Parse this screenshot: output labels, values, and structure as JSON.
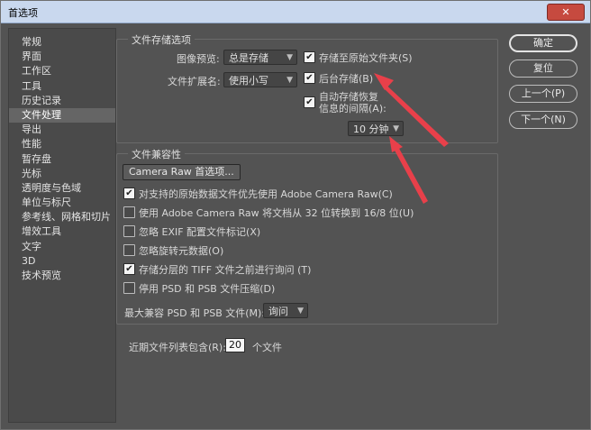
{
  "window": {
    "title": "首选项",
    "close_label": "✕"
  },
  "sidebar": {
    "items": [
      {
        "label": "常规"
      },
      {
        "label": "界面"
      },
      {
        "label": "工作区"
      },
      {
        "label": "工具"
      },
      {
        "label": "历史记录"
      },
      {
        "label": "文件处理",
        "active": true
      },
      {
        "label": "导出"
      },
      {
        "label": "性能"
      },
      {
        "label": "暂存盘"
      },
      {
        "label": "光标"
      },
      {
        "label": "透明度与色域"
      },
      {
        "label": "单位与标尺"
      },
      {
        "label": "参考线、网格和切片"
      },
      {
        "label": "增效工具"
      },
      {
        "label": "文字"
      },
      {
        "label": "3D"
      },
      {
        "label": "技术预览"
      }
    ]
  },
  "file_save": {
    "title": "文件存储选项",
    "image_preview_label": "图像预览:",
    "image_preview_value": "总是存储",
    "extension_label": "文件扩展名:",
    "extension_value": "使用小写",
    "save_original_folder": {
      "label": "存储至原始文件夹(S)",
      "checked": true
    },
    "background_save": {
      "label": "后台存储(B)",
      "checked": true
    },
    "auto_save": {
      "label_line1": "自动存储恢复",
      "label_line2": "信息的间隔(A):",
      "checked": true
    },
    "interval_value": "10 分钟"
  },
  "compat": {
    "title": "文件兼容性",
    "camera_raw_button": "Camera Raw 首选项...",
    "options": [
      {
        "label": "对支持的原始数据文件优先使用 Adobe Camera Raw(C)",
        "checked": true
      },
      {
        "label": "使用 Adobe Camera Raw 将文档从 32 位转换到 16/8 位(U)",
        "checked": false
      },
      {
        "label": "忽略 EXIF 配置文件标记(X)",
        "checked": false
      },
      {
        "label": "忽略旋转元数据(O)",
        "checked": false
      },
      {
        "label": "存储分层的 TIFF 文件之前进行询问 (T)",
        "checked": true
      },
      {
        "label": "停用 PSD 和 PSB 文件压缩(D)",
        "checked": false
      }
    ],
    "max_compat_label": "最大兼容 PSD 和 PSB 文件(M):",
    "max_compat_value": "询问"
  },
  "recent": {
    "label": "近期文件列表包含(R):",
    "value": "20",
    "suffix": "个文件"
  },
  "buttons": {
    "ok": "确定",
    "reset": "复位",
    "prev": "上一个(P)",
    "next": "下一个(N)"
  },
  "colors": {
    "annotation_arrow": "#e8404a",
    "panel_bg": "#535353",
    "titlebar": "#c9d8ee"
  }
}
